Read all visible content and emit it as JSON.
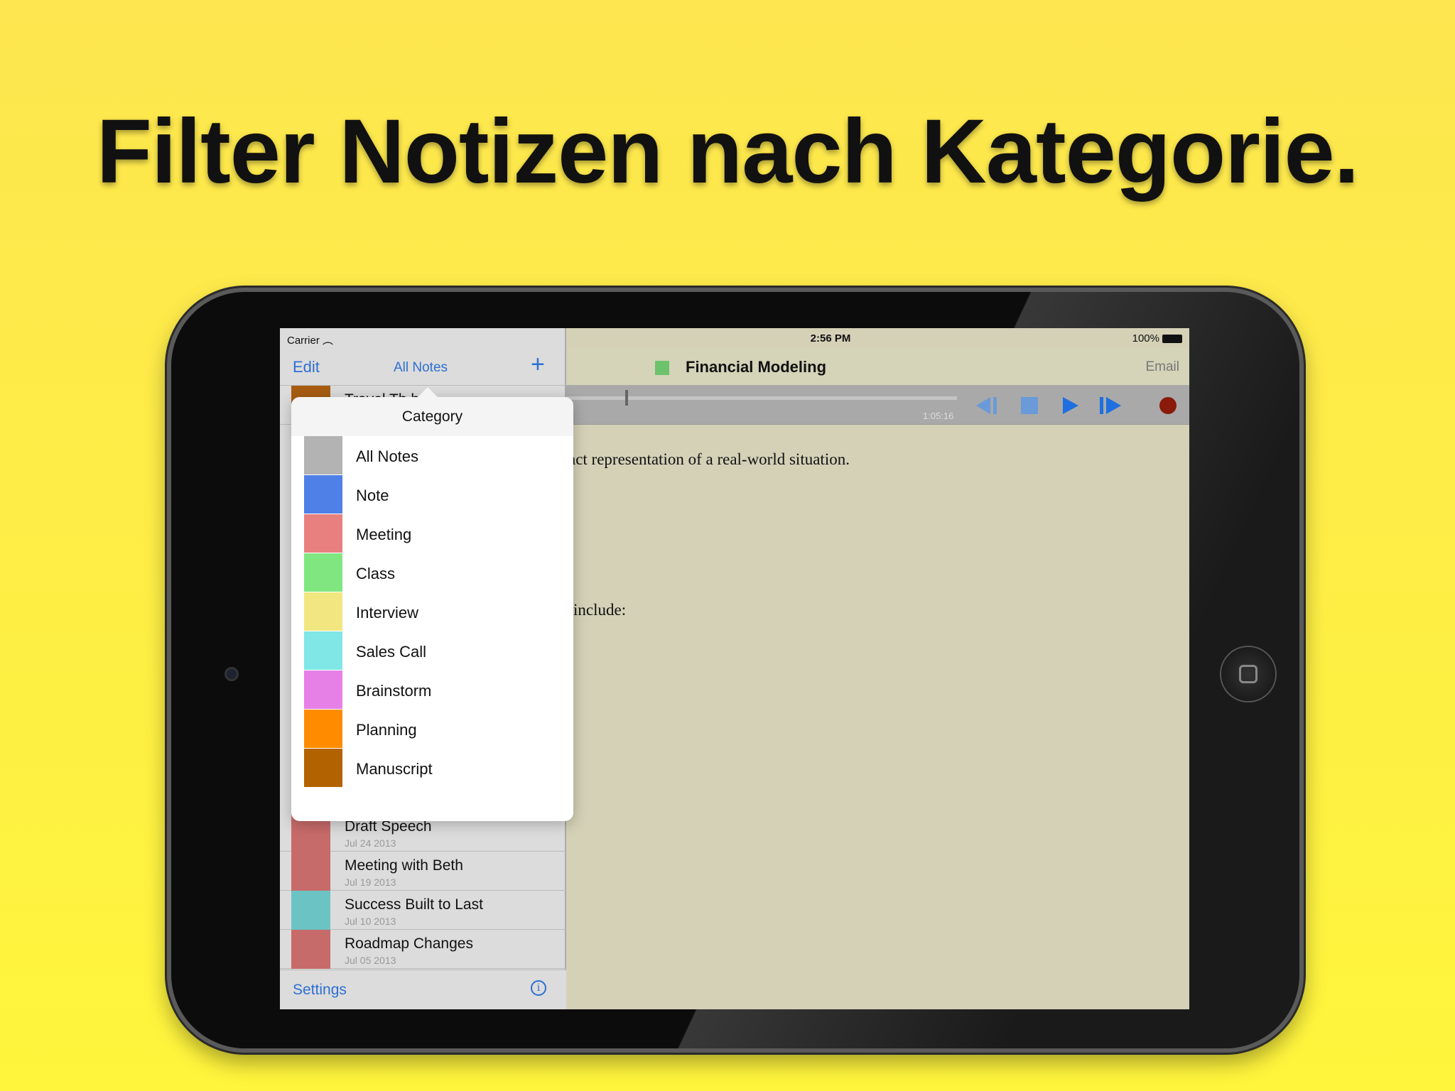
{
  "headline": "Filter Notizen nach Kategorie.",
  "status": {
    "carrier": "Carrier",
    "time": "2:56 PM",
    "battery": "100%"
  },
  "sidebar": {
    "edit": "Edit",
    "filter": "All Notes",
    "add": "+",
    "partial_row": "Travel Th   hts",
    "partial_color": "#a85e12",
    "notes": [
      {
        "title": "Draft Speech",
        "date": "Jul 24 2013",
        "color": "#c76b6a"
      },
      {
        "title": "Meeting with Beth",
        "date": "Jul 19 2013",
        "color": "#c76b6a"
      },
      {
        "title": "Success Built to Last",
        "date": "Jul 10 2013",
        "color": "#6cc3c4"
      },
      {
        "title": "Roadmap Changes",
        "date": "Jul 05 2013",
        "color": "#c76b6a"
      }
    ],
    "settings": "Settings",
    "info": "i"
  },
  "note": {
    "title": "Financial Modeling",
    "category_color": "#6cc36b",
    "email": "Email",
    "elapsed": "1:05:16",
    "progress": 0.15,
    "lines": [
      "act representation of a real-world situation.",
      "include:"
    ]
  },
  "popover": {
    "title": "Category",
    "items": [
      {
        "label": "All Notes",
        "color": "#b3b3b3"
      },
      {
        "label": "Note",
        "color": "#4f80e8"
      },
      {
        "label": "Meeting",
        "color": "#e88080"
      },
      {
        "label": "Class",
        "color": "#80e680"
      },
      {
        "label": "Interview",
        "color": "#f2e680"
      },
      {
        "label": "Sales Call",
        "color": "#80e6e6"
      },
      {
        "label": "Brainstorm",
        "color": "#e680e6"
      },
      {
        "label": "Planning",
        "color": "#ff8c00"
      },
      {
        "label": "Manuscript",
        "color": "#b36200"
      }
    ]
  }
}
